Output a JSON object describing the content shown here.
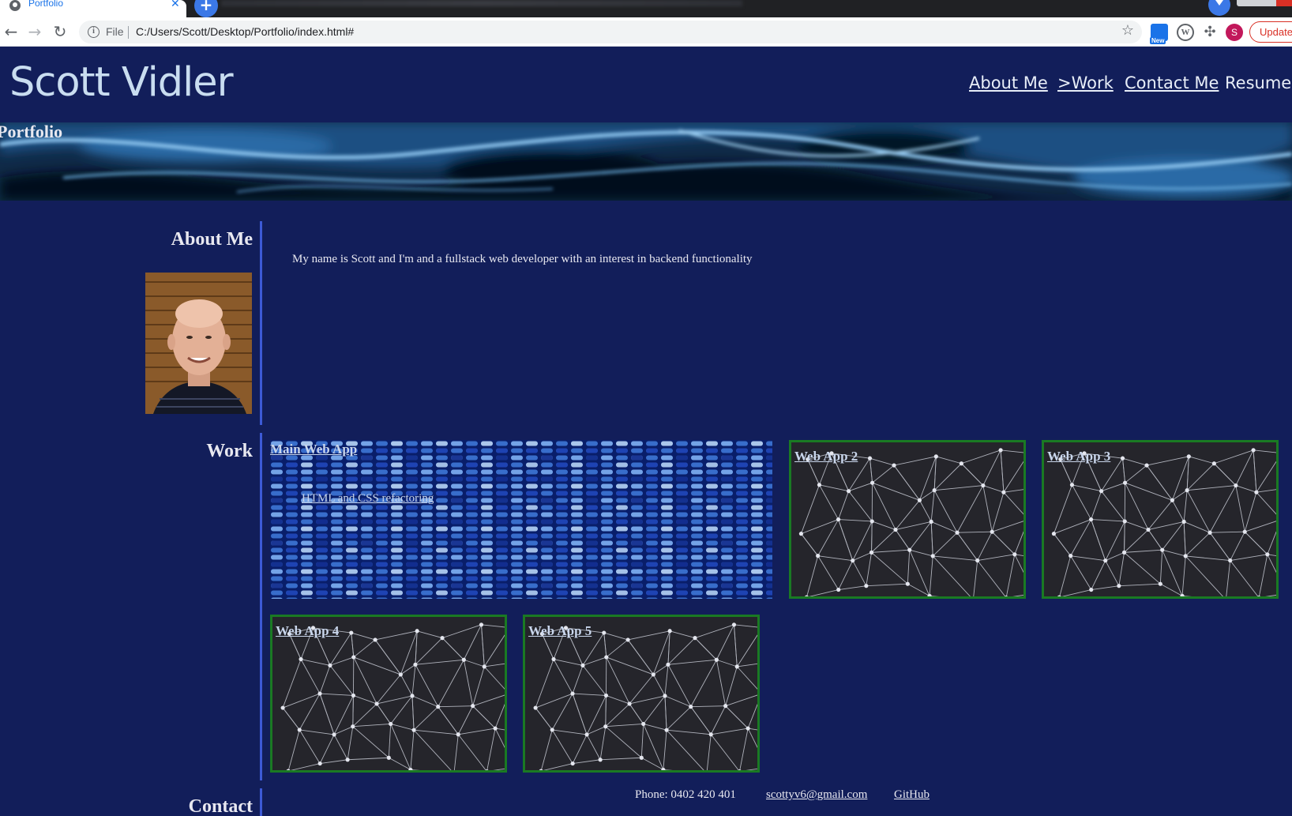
{
  "browser": {
    "tab_title": "Portfolio",
    "tab_close": "✕",
    "new_tab": "+",
    "address_prefix": "File",
    "address_url": "C:/Users/Scott/Desktop/Portfolio/index.html#",
    "extension_badge": "New",
    "avatar_letter": "S",
    "update_label": "Update"
  },
  "header": {
    "name": "Scott Vidler",
    "nav": [
      {
        "label": "About Me"
      },
      {
        "label": ">Work"
      },
      {
        "label": "Contact Me"
      },
      {
        "label": "Resume"
      }
    ]
  },
  "banner": {
    "label": "Portfolio"
  },
  "about": {
    "heading": "About Me",
    "text": "My name is Scott and I'm and a fullstack web developer with an interest in backend functionality"
  },
  "work": {
    "heading": "Work",
    "main_app": {
      "title": "Main Web App",
      "subtitle": "HTML and CSS refactoring"
    },
    "apps": [
      {
        "title": "Web App 2"
      },
      {
        "title": "Web App 3"
      },
      {
        "title": "Web App 4"
      },
      {
        "title": "Web App 5"
      }
    ]
  },
  "contact": {
    "heading": "Contact",
    "phone": "Phone: 0402 420 401",
    "email": "scottyv6@gmail.com",
    "github": "GitHub"
  },
  "colors": {
    "page_background": "#121e5a",
    "accent_rule": "#3d5ad6",
    "card_border": "#1a7a23"
  }
}
